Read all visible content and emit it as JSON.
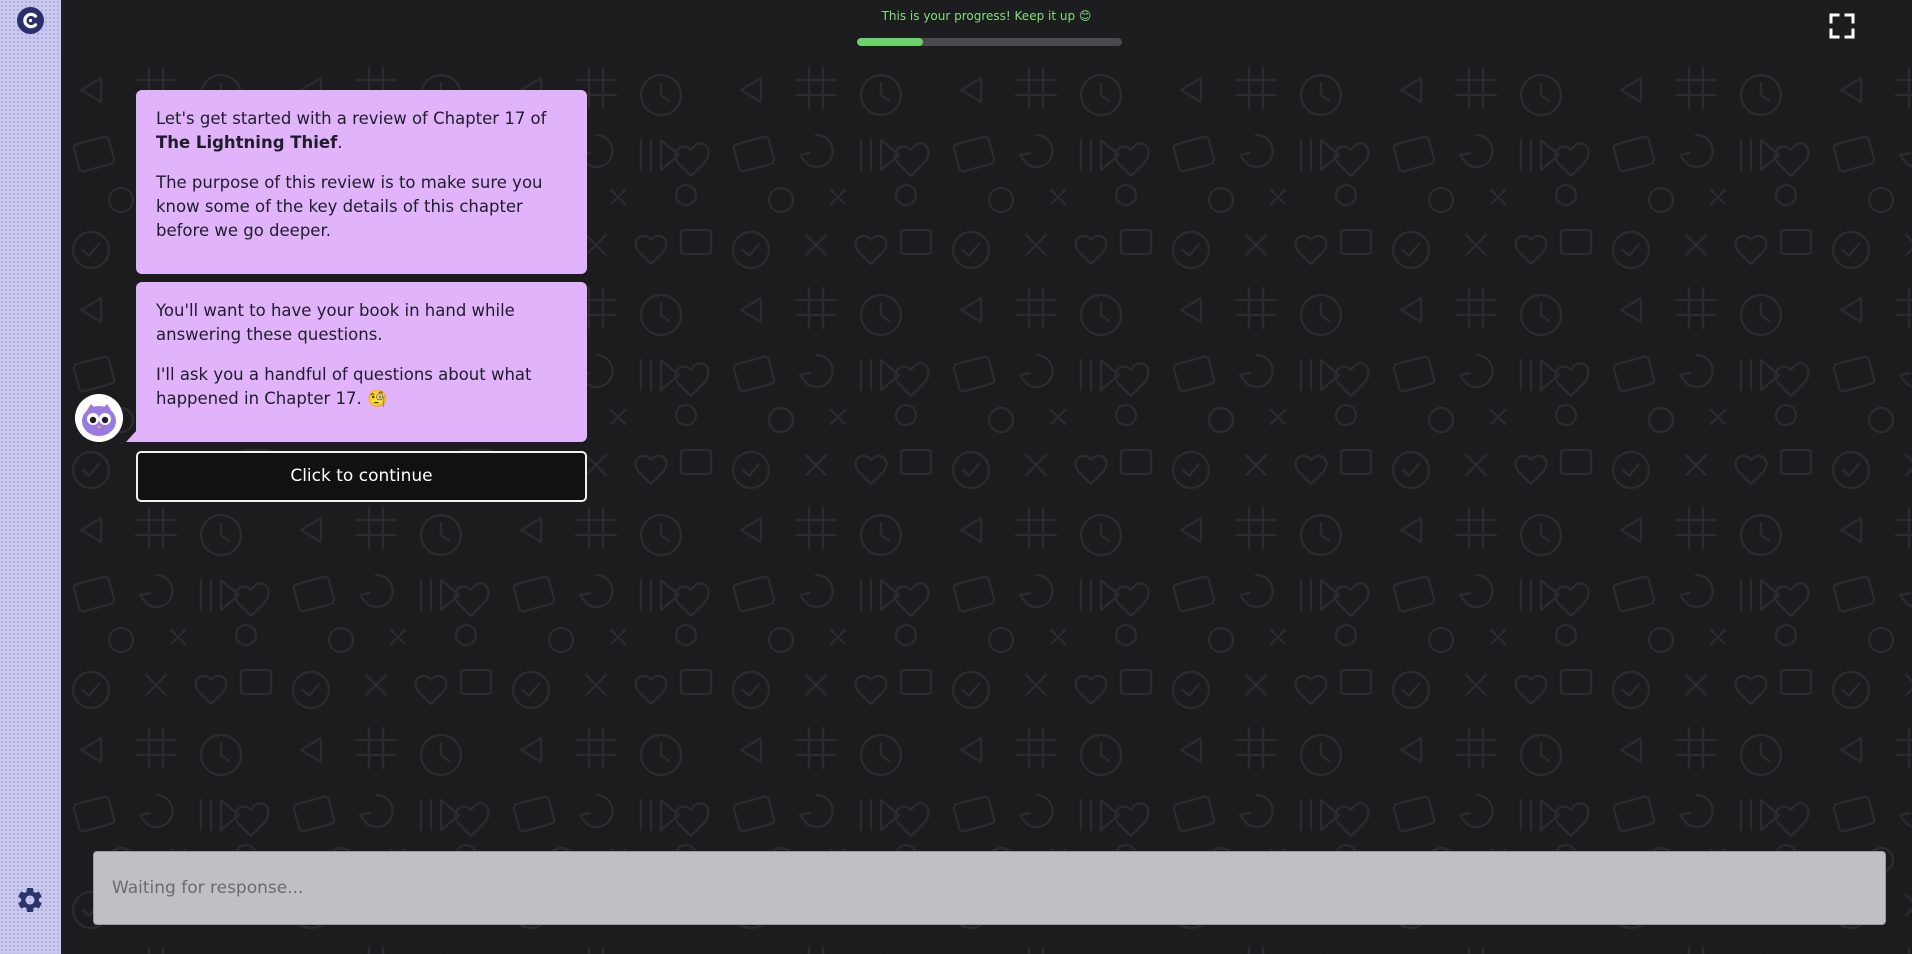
{
  "progress": {
    "label": "This is your progress! Keep it up 😊",
    "value_percent": 25
  },
  "chat": {
    "messages": [
      {
        "part1": "Let's get started with a review of Chapter 17 of ",
        "book_title": "The Lightning Thief",
        "part2": ".",
        "paragraph2": "The purpose of this review is to make sure you know some of the key details of this chapter before we go deeper."
      },
      {
        "paragraph1": "You'll want to have your book in hand while answering these questions.",
        "paragraph2": "I'll ask you a handful of questions about what happened in Chapter 17. 🧐"
      }
    ],
    "continue_label": "Click to continue"
  },
  "input": {
    "placeholder": "Waiting for response..."
  },
  "icons": {
    "logo": "logo-icon",
    "settings": "gear-icon",
    "fullscreen": "fullscreen-icon",
    "avatar": "owl-avatar-icon"
  },
  "colors": {
    "bubble": "#e0b3fb",
    "progress": "#6cd36a",
    "sidebar": "#c9c9ef",
    "background": "#1c1c1e"
  }
}
